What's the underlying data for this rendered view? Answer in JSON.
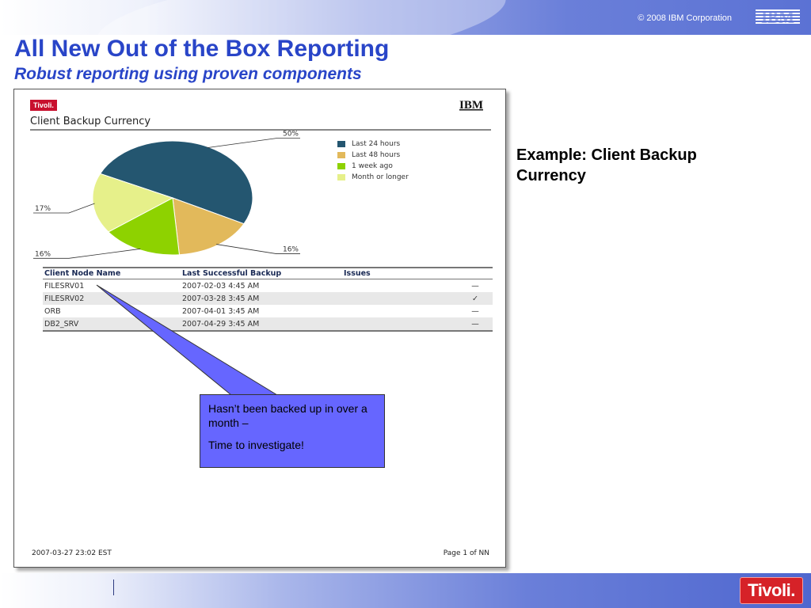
{
  "header": {
    "copyright": "© 2008 IBM Corporation",
    "ibm_logo": "IBM"
  },
  "title": "All New Out of the Box Reporting",
  "subtitle": "Robust reporting using proven components",
  "report": {
    "tivoli_logo": "Tivoli.",
    "ibm_logo": "IBM",
    "title": "Client Backup Currency",
    "columns": [
      "Client Node Name",
      "Last Successful Backup",
      "Issues"
    ],
    "rows": [
      {
        "node": "FILESRV01",
        "backup": "2007-02-03 4:45 AM",
        "issue": "—"
      },
      {
        "node": "FILESRV02",
        "backup": "2007-03-28 3:45 AM",
        "issue": "✓"
      },
      {
        "node": "ORB",
        "backup": "2007-04-01 3:45 AM",
        "issue": "—"
      },
      {
        "node": "DB2_SRV",
        "backup": "2007-04-29 3:45 AM",
        "issue": "—"
      }
    ],
    "footer_date": "2007-03-27 23:02 EST",
    "footer_page": "Page 1 of NN"
  },
  "chart_data": {
    "type": "pie",
    "title": "",
    "categories": [
      "Last 24 hours",
      "Last 48 hours",
      "1 week ago",
      "Month or longer"
    ],
    "values": [
      50,
      16,
      16,
      17
    ],
    "labels": [
      "50%",
      "16%",
      "16%",
      "17%"
    ],
    "colors": [
      "#245670",
      "#e2b95b",
      "#8ed200",
      "#e6f08a"
    ],
    "legend": "right"
  },
  "example_title": "Example: Client Backup Currency",
  "callout": {
    "line1": "Hasn’t been backed up in over a month –",
    "line2": "Time to investigate!",
    "fill": "#6666ff"
  },
  "footer": {
    "tivoli_logo": "Tivoli."
  }
}
